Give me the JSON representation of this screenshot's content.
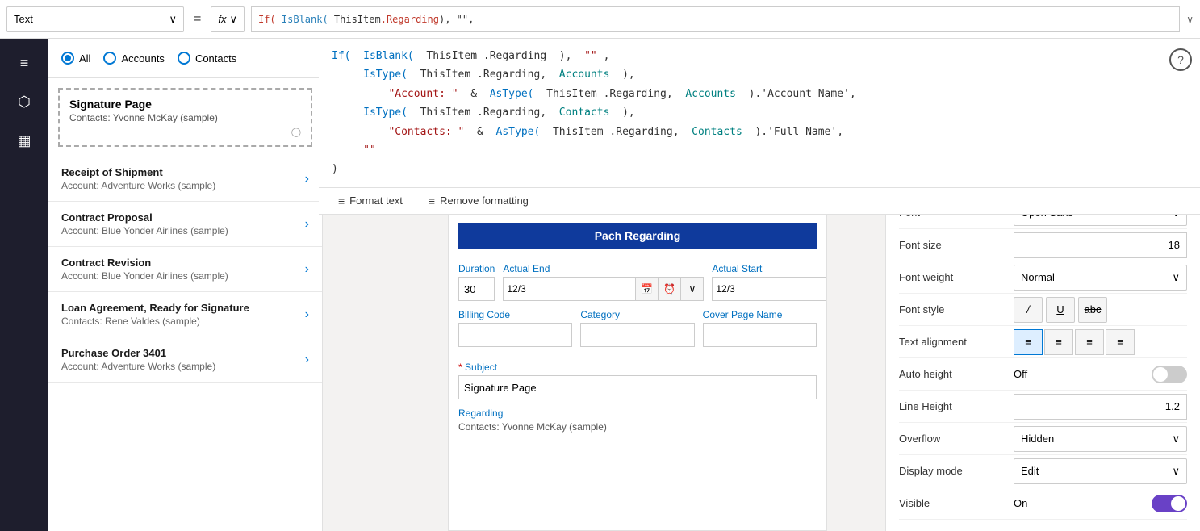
{
  "topbar": {
    "select_label": "Text",
    "equals_symbol": "=",
    "fx_label": "fx",
    "chevron": "∨"
  },
  "formula": {
    "line1_kw1": "If(",
    "line1_fn": "IsBlank(",
    "line1_obj": "ThisItem",
    "line1_dot1": ".",
    "line1_prop": "Regarding",
    "line1_paren": ")",
    "line1_str": ", \"\",",
    "line2_indent": "    ",
    "line2_fn": "IsType(",
    "line2_obj": "ThisItem",
    "line2_dot": ".",
    "line2_prop": "Regarding",
    "line2_comma": ",",
    "line2_type": "Accounts",
    "line2_close": "),",
    "line3_indent": "        ",
    "line3_str": "\"Account: \"",
    "line3_amp": " & ",
    "line3_fn": "AsType(",
    "line3_obj": "ThisItem",
    "line3_dot": ".",
    "line3_prop": "Regarding",
    "line3_comma": ",",
    "line3_type": "Accounts",
    "line3_close": ").'Account Name',",
    "line4_indent": "    ",
    "line4_fn": "IsType(",
    "line4_obj": "ThisItem",
    "line4_dot": ".",
    "line4_prop": "Regarding",
    "line4_comma": ",",
    "line4_type": "Contacts",
    "line4_close": "),",
    "line5_indent": "        ",
    "line5_str": "\"Contacts: \"",
    "line5_amp": " & ",
    "line5_fn": "AsType(",
    "line5_obj": "ThisItem",
    "line5_dot": ".",
    "line5_prop": "Regarding",
    "line5_comma": ",",
    "line5_type": "Contacts",
    "line5_close": ").'Full Name',",
    "line6": "    \"\"",
    "line7": ")"
  },
  "format_toolbar": {
    "format_text_label": "Format text",
    "remove_formatting_label": "Remove formatting"
  },
  "list_panel": {
    "radio_all": "All",
    "radio_accounts": "Accounts",
    "radio_contacts": "Contacts",
    "signature_title": "Signature Page",
    "signature_sub": "Contacts: Yvonne McKay (sample)",
    "items": [
      {
        "title": "Receipt of Shipment",
        "sub": "Account: Adventure Works (sample)"
      },
      {
        "title": "Contract Proposal",
        "sub": "Account: Blue Yonder Airlines (sample)"
      },
      {
        "title": "Contract Revision",
        "sub": "Account: Blue Yonder Airlines (sample)"
      },
      {
        "title": "Loan Agreement, Ready for Signature",
        "sub": "Contacts: Rene Valdes (sample)"
      },
      {
        "title": "Purchase Order 3401",
        "sub": "Account: Adventure Works (sample)"
      }
    ]
  },
  "form": {
    "contact_value": "Yvonne McKay (sample)",
    "pach_btn_label": "Pach Regarding",
    "duration_label": "Duration",
    "duration_value": "30",
    "actual_end_label": "Actual End",
    "actual_end_value": "12/3",
    "actual_start_label": "Actual Start",
    "actual_start_value": "12/3",
    "billing_code_label": "Billing Code",
    "billing_code_value": "",
    "category_label": "Category",
    "category_value": "",
    "cover_page_label": "Cover Page Name",
    "cover_page_value": "",
    "subject_label": "Subject",
    "subject_value": "Signature Page",
    "regarding_label": "Regarding",
    "regarding_value": "Contacts: Yvonne McKay (sample)"
  },
  "props": {
    "font_label": "Font",
    "font_value": "Open Sans",
    "font_size_label": "Font size",
    "font_size_value": "18",
    "font_weight_label": "Font weight",
    "font_weight_value": "Normal",
    "font_style_label": "Font style",
    "italic_label": "/",
    "underline_label": "U",
    "strikethrough_label": "abc",
    "text_alignment_label": "Text alignment",
    "auto_height_label": "Auto height",
    "auto_height_off": "Off",
    "line_height_label": "Line Height",
    "line_height_value": "1.2",
    "overflow_label": "Overflow",
    "overflow_value": "Hidden",
    "display_mode_label": "Display mode",
    "display_mode_value": "Edit",
    "visible_label": "Visible",
    "visible_on": "On"
  },
  "sidebar": {
    "icons": [
      "≡",
      "⬡",
      "▦"
    ]
  }
}
